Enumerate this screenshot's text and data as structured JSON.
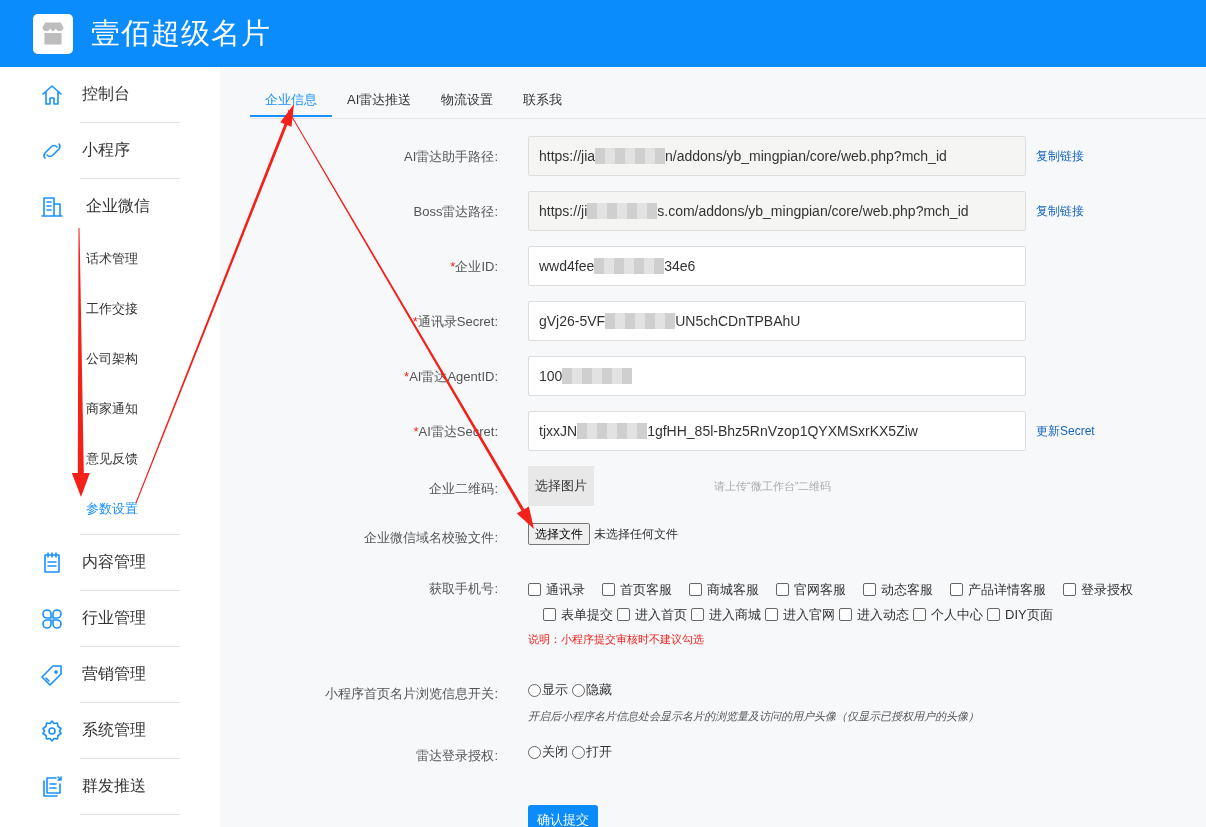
{
  "header": {
    "title": "壹佰超级名片"
  },
  "sidebar": {
    "items": [
      {
        "label": "控制台",
        "expanded": false
      },
      {
        "label": "小程序",
        "expanded": false
      },
      {
        "label": "企业微信",
        "expanded": true,
        "children": [
          {
            "label": "话术管理",
            "selected": false
          },
          {
            "label": "工作交接",
            "selected": false
          },
          {
            "label": "公司架构",
            "selected": false
          },
          {
            "label": "商家通知",
            "selected": false
          },
          {
            "label": "意见反馈",
            "selected": false
          },
          {
            "label": "参数设置",
            "selected": true
          }
        ]
      },
      {
        "label": "内容管理",
        "expanded": false
      },
      {
        "label": "行业管理",
        "expanded": false
      },
      {
        "label": "营销管理",
        "expanded": false
      },
      {
        "label": "系统管理",
        "expanded": false
      },
      {
        "label": "群发推送",
        "expanded": false
      }
    ]
  },
  "tabs": [
    {
      "label": "企业信息",
      "selected": true
    },
    {
      "label": "AI雷达推送",
      "selected": false
    },
    {
      "label": "物流设置",
      "selected": false
    },
    {
      "label": "联系我",
      "selected": false
    }
  ],
  "form": [
    {
      "kind": "readonly",
      "label": "AI雷达助手路径:",
      "value_start": "https://jia",
      "value_end": "n/addons/yb_mingpian/core/web.php?mch_id",
      "link": "复制链接"
    },
    {
      "kind": "readonly",
      "label": "Boss雷达路径:",
      "value_start": "https://ji",
      "value_end": "s.com/addons/yb_mingpian/core/web.php?mch_id",
      "link": "复制链接"
    },
    {
      "kind": "input",
      "required_mark": "*",
      "label": "企业ID:",
      "value_start": "wwd4fee",
      "value_end": "34e6"
    },
    {
      "kind": "input",
      "required_mark": "*",
      "label": "通讯录Secret:",
      "value_start": "gVj26-5VF",
      "value_end": "UN5chCDnTPBAhU"
    },
    {
      "kind": "input",
      "required_mark": "*",
      "label": "AI雷达AgentID:",
      "value_start": "100"
    },
    {
      "kind": "input",
      "required_mark": "*",
      "label": "AI雷达Secret:",
      "value_start": "tjxxJN",
      "value_end": "1gfHH_85l-Bhz5RnVzop1QYXMSxrKX5Ziw",
      "link": "更新Secret"
    },
    {
      "kind": "image",
      "label": "企业二维码:",
      "button": "选择图片",
      "hint": "请上传“微工作台”二维码"
    },
    {
      "kind": "file",
      "label": "企业微信域名校验文件:",
      "button": "选择文件",
      "status": "未选择任何文件"
    },
    {
      "kind": "checkboxes",
      "label": "获取手机号:",
      "options": [
        {
          "label": "通讯录",
          "checked": false
        },
        {
          "label": "首页客服",
          "checked": false
        },
        {
          "label": "商城客服",
          "checked": false
        },
        {
          "label": "官网客服",
          "checked": false
        },
        {
          "label": "动态客服",
          "checked": false
        },
        {
          "label": "产品详情客服",
          "checked": false
        },
        {
          "label": "登录授权",
          "checked": false
        },
        {
          "label": "表单提交",
          "checked": false
        },
        {
          "label": "进入首页",
          "checked": false
        },
        {
          "label": "进入商城",
          "checked": false
        },
        {
          "label": "进入官网",
          "checked": false
        },
        {
          "label": "进入动态",
          "checked": false
        },
        {
          "label": "个人中心",
          "checked": false
        },
        {
          "label": "DIY页面",
          "checked": false
        }
      ],
      "note": "说明：小程序提交审核时不建议勾选"
    },
    {
      "kind": "radios",
      "label": "小程序首页名片浏览信息开关:",
      "options": [
        {
          "label": "显示",
          "selected": false
        },
        {
          "label": "隐藏",
          "selected": false
        }
      ],
      "hint": "开启后小程序名片信息处会显示名片的浏览量及访问的用户头像（仅显示已授权用户的头像）"
    },
    {
      "kind": "radios",
      "label": "雷达登录授权:",
      "options": [
        {
          "label": "关闭",
          "selected": false
        },
        {
          "label": "打开",
          "selected": false
        }
      ]
    },
    {
      "kind": "submit",
      "button": "确认提交"
    }
  ],
  "annotations": [
    {
      "kind": "arrow"
    },
    {
      "kind": "arrow"
    },
    {
      "kind": "arrow"
    }
  ]
}
